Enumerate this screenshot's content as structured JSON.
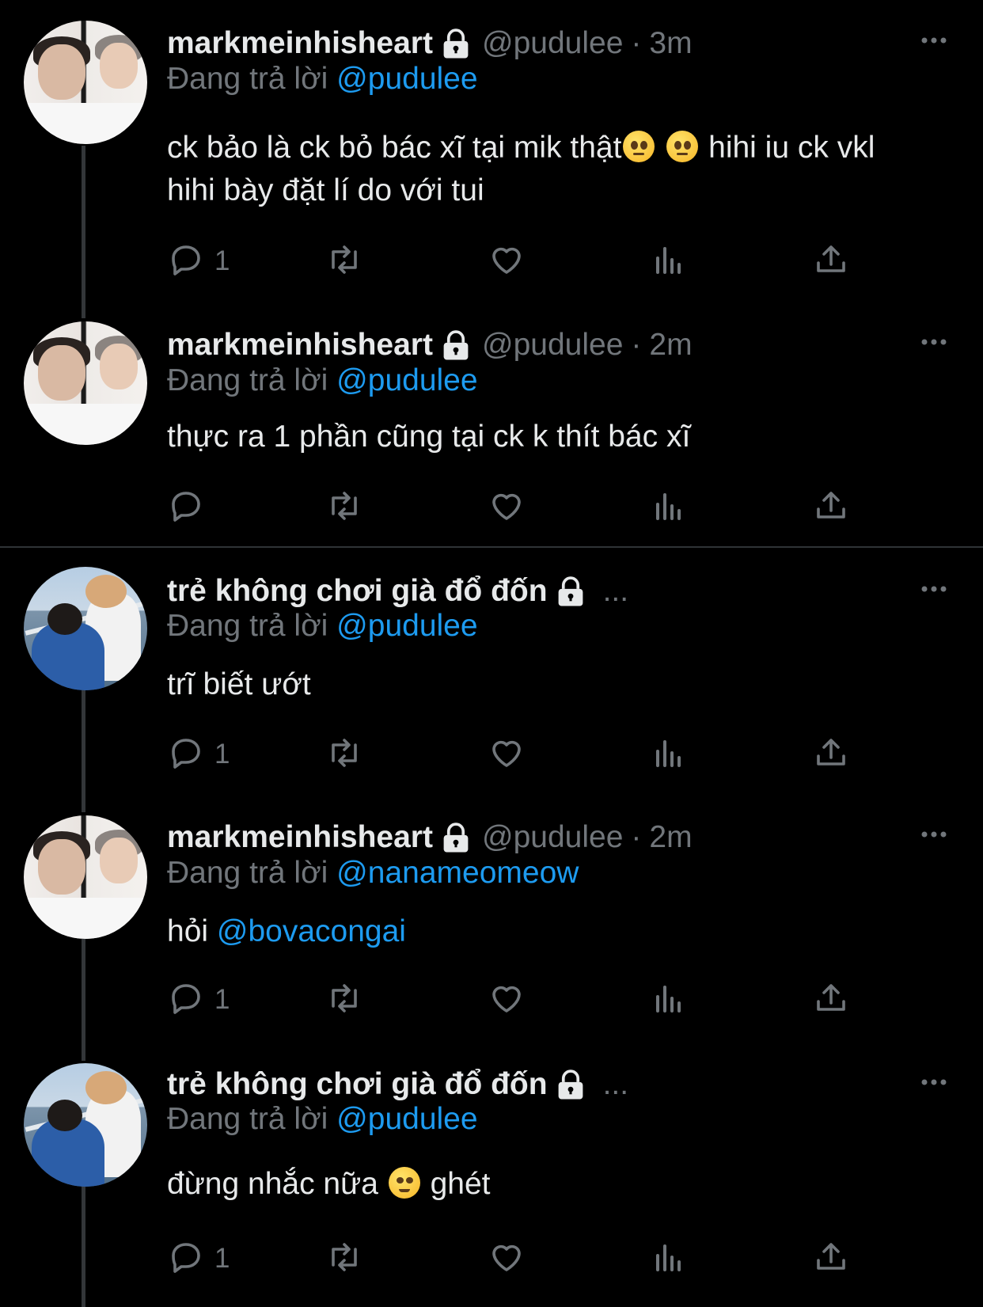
{
  "tweets": [
    {
      "name": "markmeinhisheart",
      "handle": "@pudulee",
      "separator": "·",
      "time": "3m",
      "reply_prefix": "Đang trả lời",
      "reply_to": "@pudulee",
      "text_1": "ck bảo là ck bỏ bác xĩ tại mik thật",
      "text_2": "hihi iu ck vkl hihi bày đặt lí do với tui",
      "emoji": "pleading-face",
      "reply_count": "1",
      "avatar": "avatar-a"
    },
    {
      "name": "markmeinhisheart",
      "handle": "@pudulee",
      "separator": "·",
      "time": "2m",
      "reply_prefix": "Đang trả lời",
      "reply_to": "@pudulee",
      "text_1": "thực ra 1 phần cũng tại ck k thít bác xĩ",
      "reply_count": "",
      "avatar": "avatar-a"
    },
    {
      "name": "trẻ không chơi già đổ đốn",
      "ellipsis": "...",
      "reply_prefix": "Đang trả lời",
      "reply_to": "@pudulee",
      "text_1": "trĩ biết ướt",
      "reply_count": "1",
      "avatar": "avatar-b"
    },
    {
      "name": "markmeinhisheart",
      "handle": "@pudulee",
      "separator": "·",
      "time": "2m",
      "reply_prefix": "Đang trả lời",
      "reply_to": "@nanameomeow",
      "text_1": "hỏi",
      "text_mention": "@bovacongai",
      "reply_count": "1",
      "avatar": "avatar-a"
    },
    {
      "name": "trẻ không chơi già đổ đốn",
      "ellipsis": "...",
      "reply_prefix": "Đang trả lời",
      "reply_to": "@pudulee",
      "text_1": "đừng nhắc nữa",
      "text_2": "ghét",
      "emoji": "slightly-smiling-face",
      "reply_count": "1",
      "avatar": "avatar-b"
    }
  ],
  "icons": {
    "lock": "lock-icon",
    "more": "more-icon",
    "reply": "reply-icon",
    "retweet": "retweet-icon",
    "like": "like-icon",
    "views": "views-icon",
    "share": "share-icon"
  },
  "colors": {
    "background": "#000000",
    "text": "#e7e9ea",
    "secondary": "#71767b",
    "accent": "#1d9bf0"
  }
}
